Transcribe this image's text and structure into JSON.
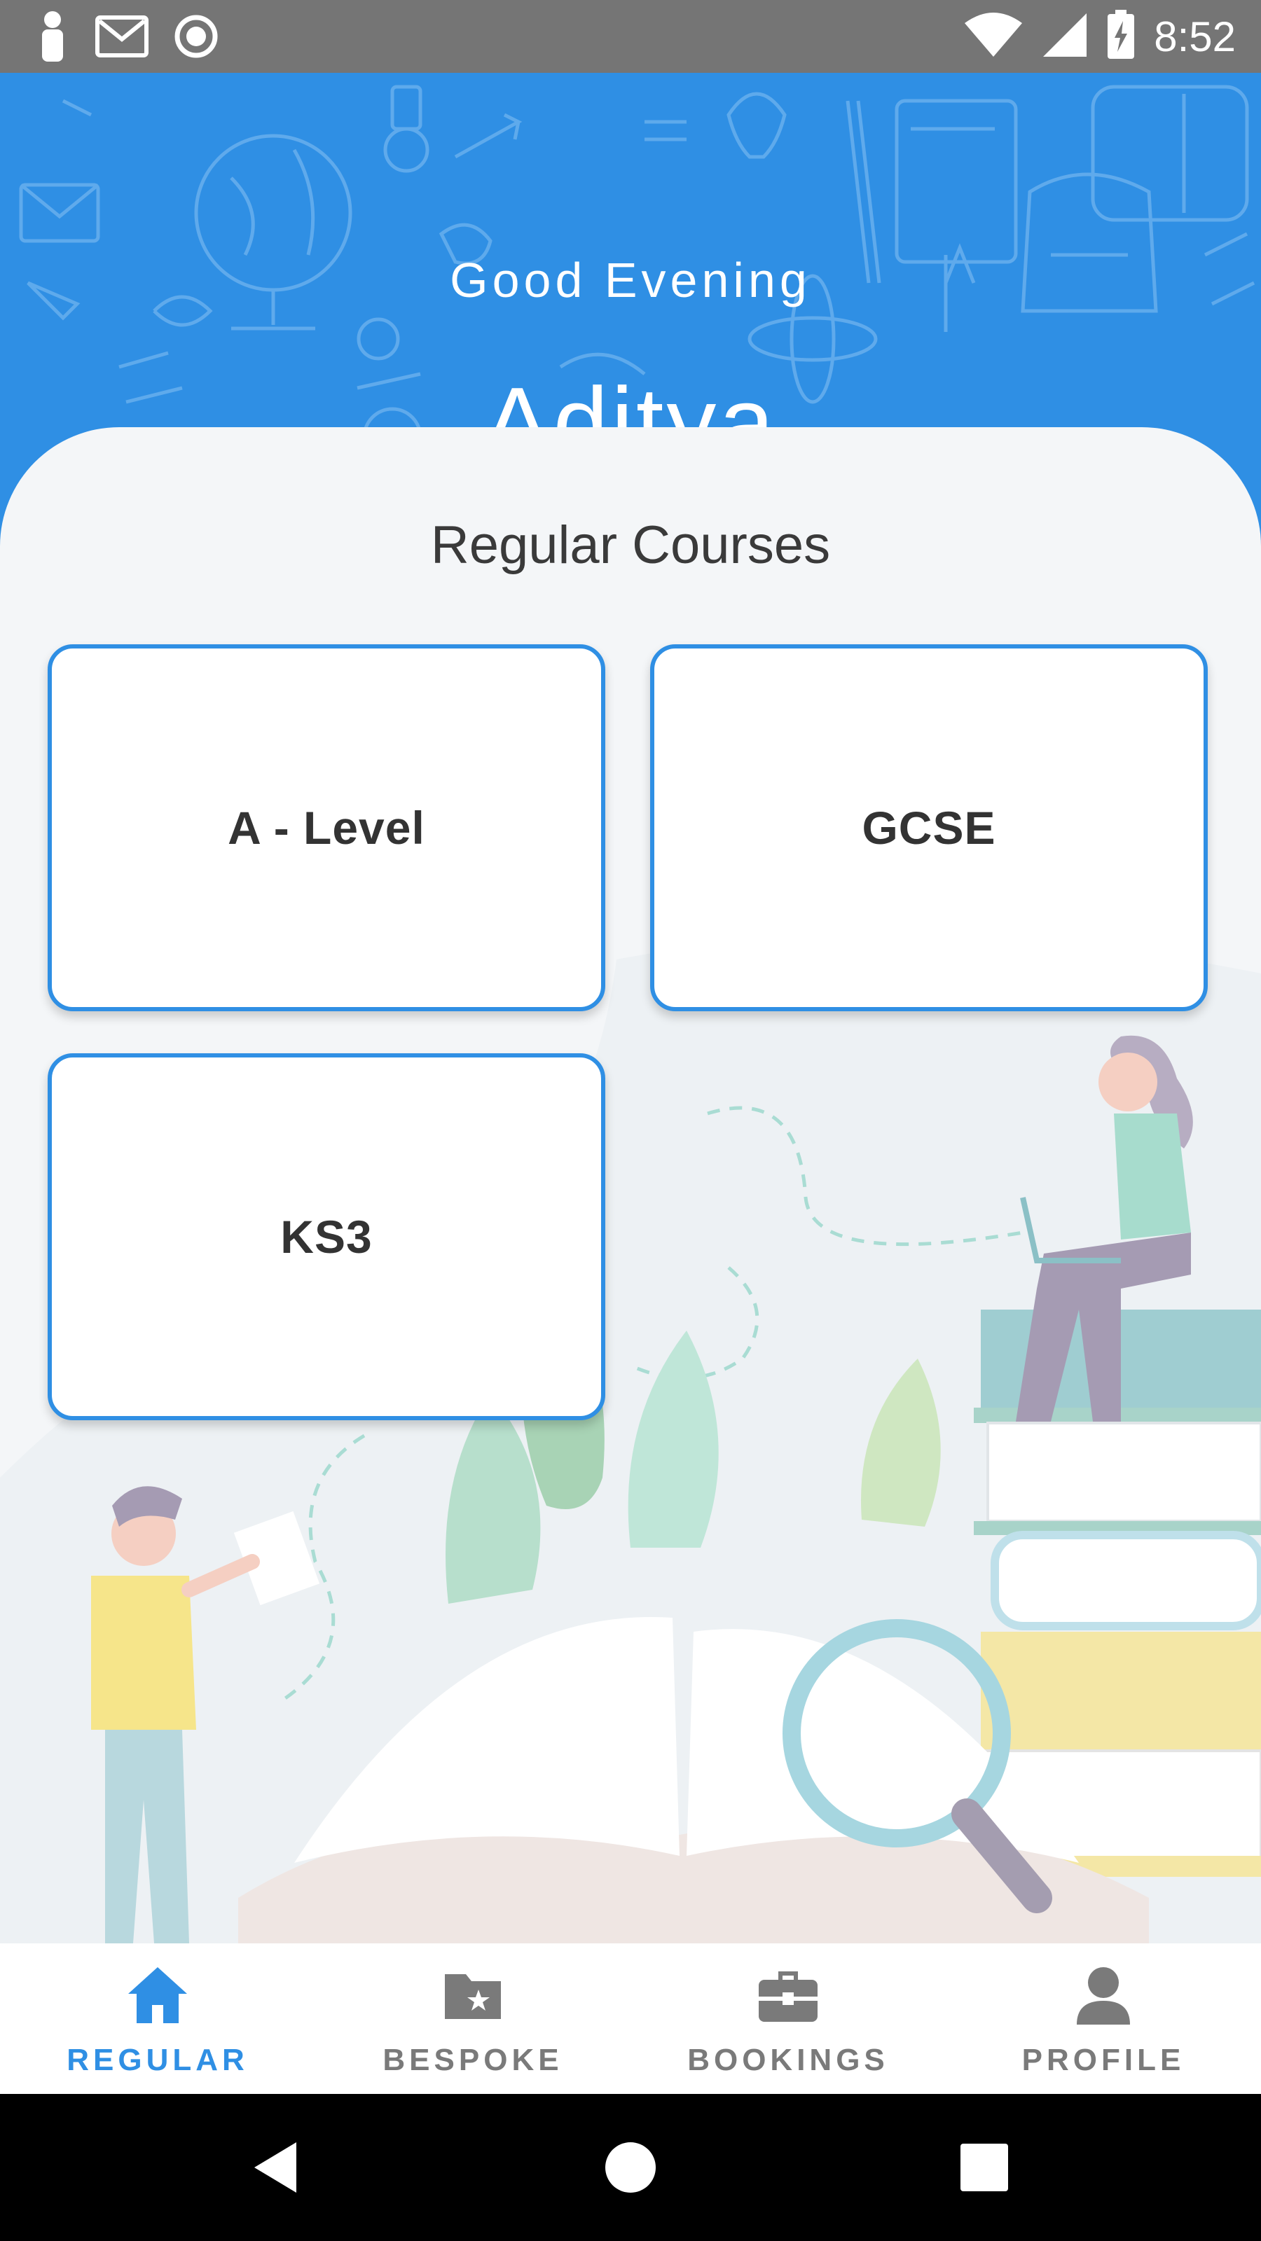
{
  "status_bar": {
    "time": "8:52",
    "left_icons": [
      "person-icon",
      "gmail-icon",
      "record-icon"
    ],
    "right_icons": [
      "wifi-icon",
      "signal-icon",
      "battery-charging-icon"
    ]
  },
  "header": {
    "greeting": "Good Evening",
    "user_name": "Aditya",
    "background_color": "#2f8fe4"
  },
  "main": {
    "section_title": "Regular Courses",
    "courses": [
      {
        "label": "A - Level"
      },
      {
        "label": "GCSE"
      },
      {
        "label": "KS3"
      }
    ]
  },
  "bottom_nav": {
    "active_color": "#2f8fe4",
    "inactive_color": "#7a7a7a",
    "items": [
      {
        "label": "REGULAR",
        "icon": "home-icon",
        "active": true
      },
      {
        "label": "BESPOKE",
        "icon": "folder-star-icon",
        "active": false
      },
      {
        "label": "BOOKINGS",
        "icon": "briefcase-icon",
        "active": false
      },
      {
        "label": "PROFILE",
        "icon": "person-icon",
        "active": false
      }
    ]
  },
  "system_nav": {
    "buttons": [
      "back-icon",
      "home-circle-icon",
      "recents-icon"
    ]
  }
}
